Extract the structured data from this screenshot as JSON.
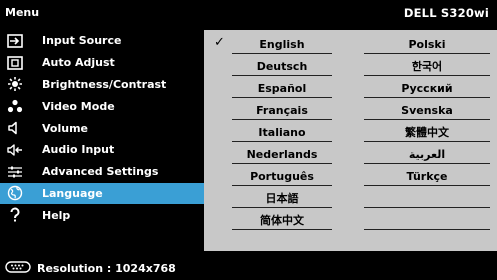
{
  "header": {
    "title": "Menu",
    "model": "DELL S320wi"
  },
  "menu": {
    "selected_index": 7,
    "items": [
      {
        "label": "Input Source",
        "icon": "input-source-icon"
      },
      {
        "label": "Auto Adjust",
        "icon": "auto-adjust-icon"
      },
      {
        "label": "Brightness/Contrast",
        "icon": "brightness-icon"
      },
      {
        "label": "Video Mode",
        "icon": "video-mode-icon"
      },
      {
        "label": "Volume",
        "icon": "volume-icon"
      },
      {
        "label": "Audio Input",
        "icon": "audio-input-icon"
      },
      {
        "label": "Advanced Settings",
        "icon": "advanced-settings-icon"
      },
      {
        "label": "Language",
        "icon": "language-globe-icon"
      },
      {
        "label": "Help",
        "icon": "help-icon"
      }
    ]
  },
  "languages": {
    "selected": "English",
    "check_mark": "✓",
    "col1": [
      "English",
      "Deutsch",
      "Español",
      "Français",
      "Italiano",
      "Nederlands",
      "Português",
      "日本語",
      "简体中文"
    ],
    "col2": [
      "Polski",
      "한국어",
      "Русский",
      "Svenska",
      "繁體中文",
      "العربية",
      "Türkçe",
      "",
      ""
    ]
  },
  "footer": {
    "resolution_text": "Resolution : 1024x768",
    "icon": "resolution-icon"
  },
  "colors": {
    "selection": "#3a9fd5",
    "panel": "#c8c8c8",
    "background": "#000000"
  }
}
